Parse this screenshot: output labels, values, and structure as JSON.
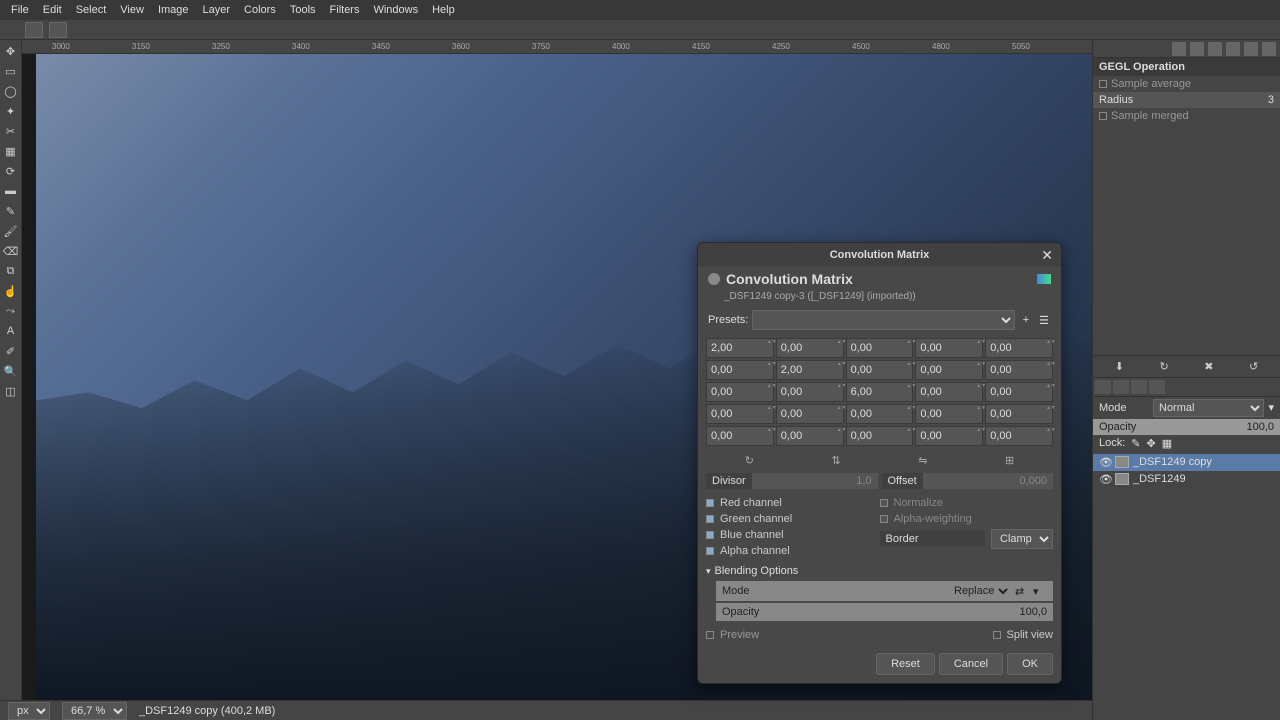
{
  "menubar": [
    "File",
    "Edit",
    "Select",
    "View",
    "Image",
    "Layer",
    "Colors",
    "Tools",
    "Filters",
    "Windows",
    "Help"
  ],
  "ruler_ticks": [
    "3000",
    "3150",
    "3250",
    "3400",
    "3450",
    "3600",
    "3750",
    "4000",
    "4150",
    "4250",
    "4500",
    "4800",
    "5050"
  ],
  "right_panel": {
    "title": "GEGL Operation",
    "sample_average": "Sample average",
    "radius_label": "Radius",
    "radius_value": "3",
    "sample_merged": "Sample merged",
    "mode_label": "Mode",
    "mode_value": "Normal",
    "opacity_label": "Opacity",
    "opacity_value": "100,0",
    "lock_label": "Lock:"
  },
  "layers": [
    {
      "name": "_DSF1249 copy",
      "active": true
    },
    {
      "name": "_DSF1249",
      "active": false
    }
  ],
  "statusbar": {
    "unit": "px",
    "zoom": "66,7 %",
    "info": "_DSF1249 copy (400,2 MB)"
  },
  "dialog": {
    "window_title": "Convolution Matrix",
    "title": "Convolution Matrix",
    "subtitle": "_DSF1249 copy-3 ([_DSF1249] (imported))",
    "presets_label": "Presets:",
    "matrix": [
      [
        "2,00",
        "0,00",
        "0,00",
        "0,00",
        "0,00"
      ],
      [
        "0,00",
        "2,00",
        "0,00",
        "0,00",
        "0,00"
      ],
      [
        "0,00",
        "0,00",
        "6,00",
        "0,00",
        "0,00"
      ],
      [
        "0,00",
        "0,00",
        "0,00",
        "0,00",
        "0,00"
      ],
      [
        "0,00",
        "0,00",
        "0,00",
        "0,00",
        "0,00"
      ]
    ],
    "divisor_label": "Divisor",
    "divisor_value": "1,0",
    "offset_label": "Offset",
    "offset_value": "0,000",
    "red": "Red channel",
    "green": "Green channel",
    "blue": "Blue channel",
    "alpha": "Alpha channel",
    "normalize": "Normalize",
    "alpha_weight": "Alpha-weighting",
    "border_label": "Border",
    "border_value": "Clamp",
    "blending": "Blending Options",
    "mode_label": "Mode",
    "mode_value": "Replace",
    "opacity_label": "Opacity",
    "opacity_value": "100,0",
    "preview": "Preview",
    "split": "Split view",
    "reset": "Reset",
    "cancel": "Cancel",
    "ok": "OK"
  }
}
